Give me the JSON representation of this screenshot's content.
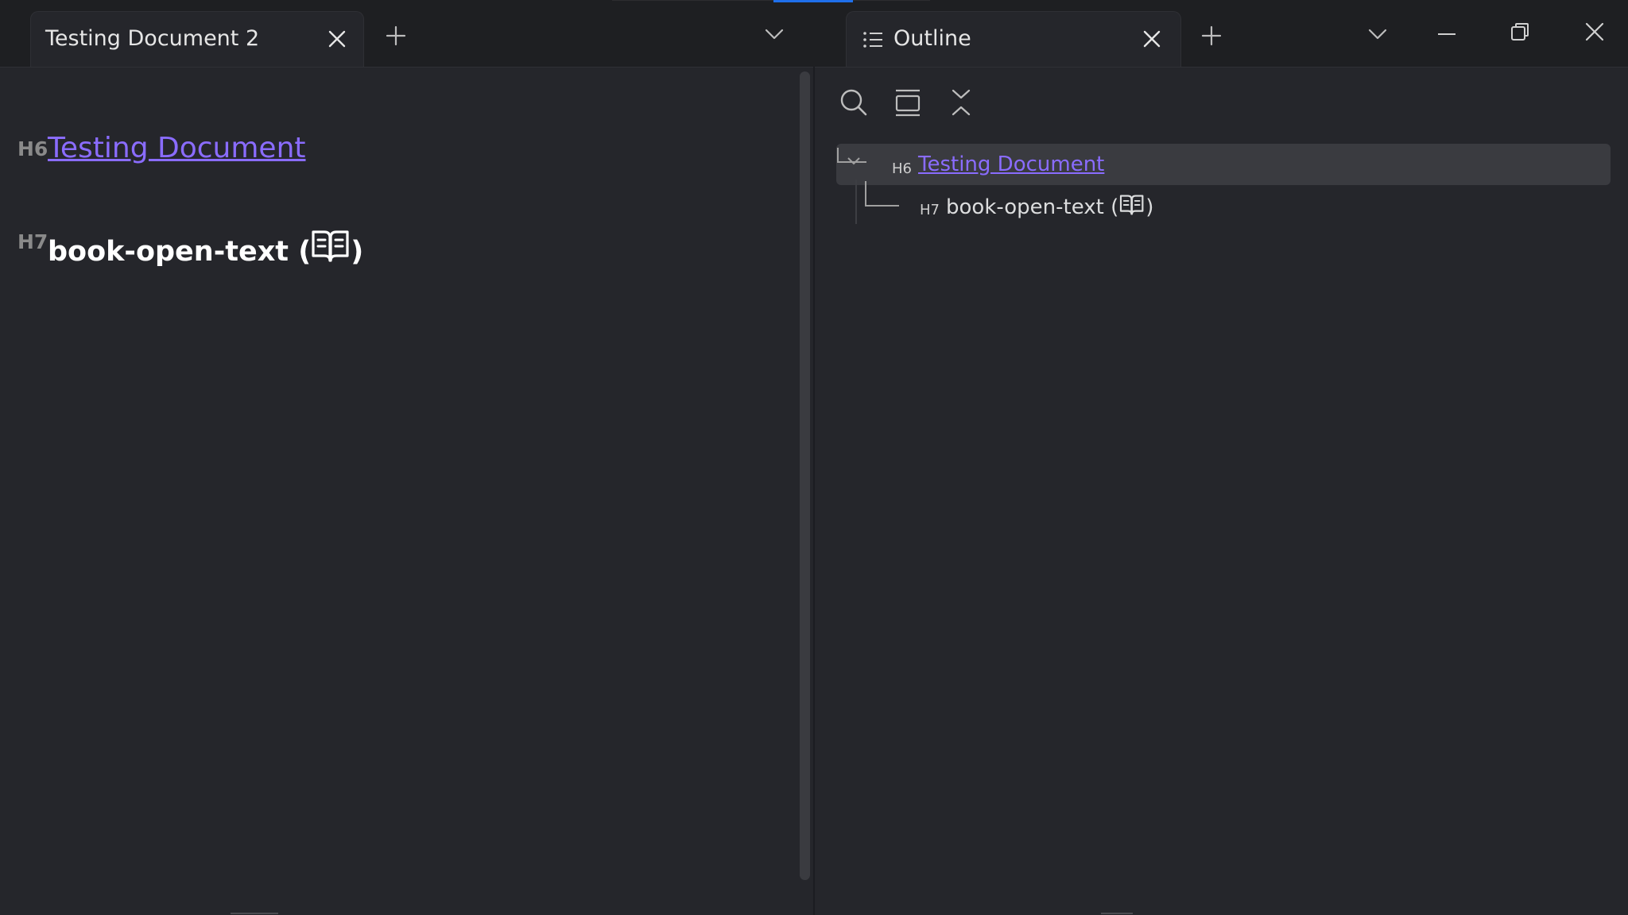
{
  "left_tab": {
    "title": "Testing Document 2"
  },
  "right_tab": {
    "title": "Outline"
  },
  "editor": {
    "h6": {
      "label": "H6",
      "text": "Testing Document"
    },
    "h7": {
      "label": "H7",
      "text_before": "book-open-text (",
      "text_after": ")"
    }
  },
  "outline": {
    "items": [
      {
        "level_label": "H6",
        "text": "Testing Document"
      },
      {
        "level_label": "H7",
        "text_before": "book-open-text (",
        "text_after": ")"
      }
    ]
  },
  "colors": {
    "accent": "#1f6feb",
    "link": "#8a6cff",
    "background": "#25262b"
  },
  "icons": {
    "tab_close": "close-icon",
    "new_tab": "plus-icon",
    "tab_list": "chevron-down-icon",
    "outline": "list-icon",
    "search": "search-icon",
    "collapse": "collapse-all-icon",
    "minimize": "minimize-icon",
    "restore": "restore-icon",
    "window_close": "window-close-icon",
    "book": "book-open-text-icon"
  }
}
